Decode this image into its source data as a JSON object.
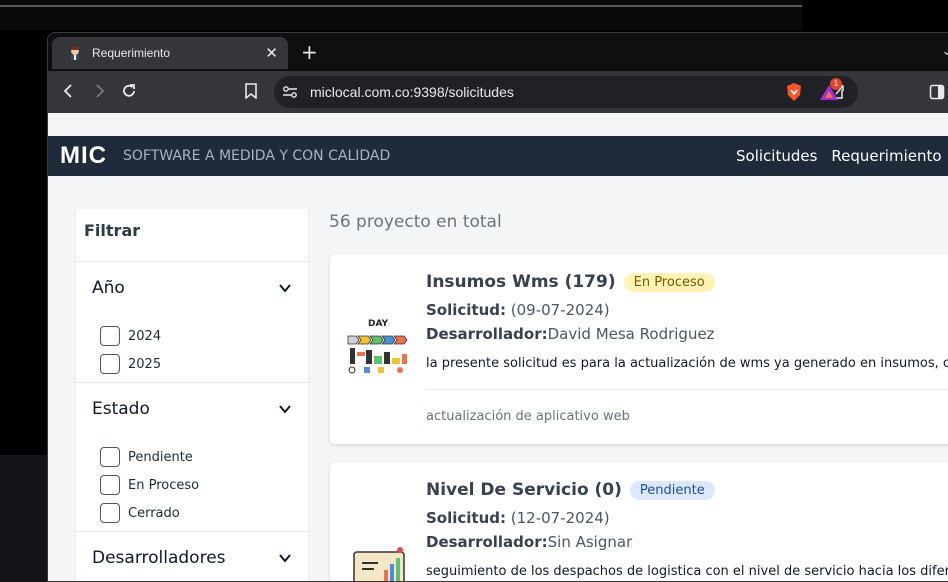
{
  "browser": {
    "tab_title": "Requerimiento",
    "tab_close": "✕",
    "new_tab": "+",
    "url": "miclocal.com.co:9398/solicitudes",
    "notification_count": "1"
  },
  "app": {
    "brand": "MIC",
    "tagline": "SOFTWARE A MEDIDA Y CON CALIDAD",
    "nav": [
      "Solicitudes",
      "Requerimiento"
    ]
  },
  "filter": {
    "title": "Filtrar",
    "sections": [
      {
        "label": "Año",
        "options": [
          "2024",
          "2025"
        ]
      },
      {
        "label": "Estado",
        "options": [
          "Pendiente",
          "En Proceso",
          "Cerrado"
        ]
      },
      {
        "label": "Desarrolladores",
        "options": []
      }
    ]
  },
  "summary": "56 proyecto en total",
  "projects": [
    {
      "title": "Insumos Wms (179)",
      "status": "En Proceso",
      "solicitud_label": "Solicitud:",
      "solicitud_date": " (09-07-2024)",
      "dev_label": "Desarrollador:",
      "dev_name": "David Mesa Rodriguez",
      "description": "la presente solicitud es para la actualización de wms ya generado en insumos, c",
      "footer": "actualización de aplicativo web",
      "image_text": "DAY"
    },
    {
      "title": "Nivel De Servicio (0)",
      "status": "Pendiente",
      "solicitud_label": "Solicitud:",
      "solicitud_date": " (12-07-2024)",
      "dev_label": "Desarrollador:",
      "dev_name": "Sin Asignar",
      "description": "seguimiento de los despachos de logistica con el nivel de servicio hacia los difer"
    }
  ],
  "colors": {
    "header_bg": "#1f2a3b",
    "badge_in_progress": "#fdf3b5",
    "badge_pending": "#dde9fb"
  },
  "icons": [
    "back-icon",
    "forward-icon",
    "reload-icon",
    "bookmark-icon",
    "site-info-icon",
    "share-icon",
    "brave-shield-icon",
    "brave-rewards-icon",
    "sidebar-icon",
    "chevron-down-icon"
  ]
}
